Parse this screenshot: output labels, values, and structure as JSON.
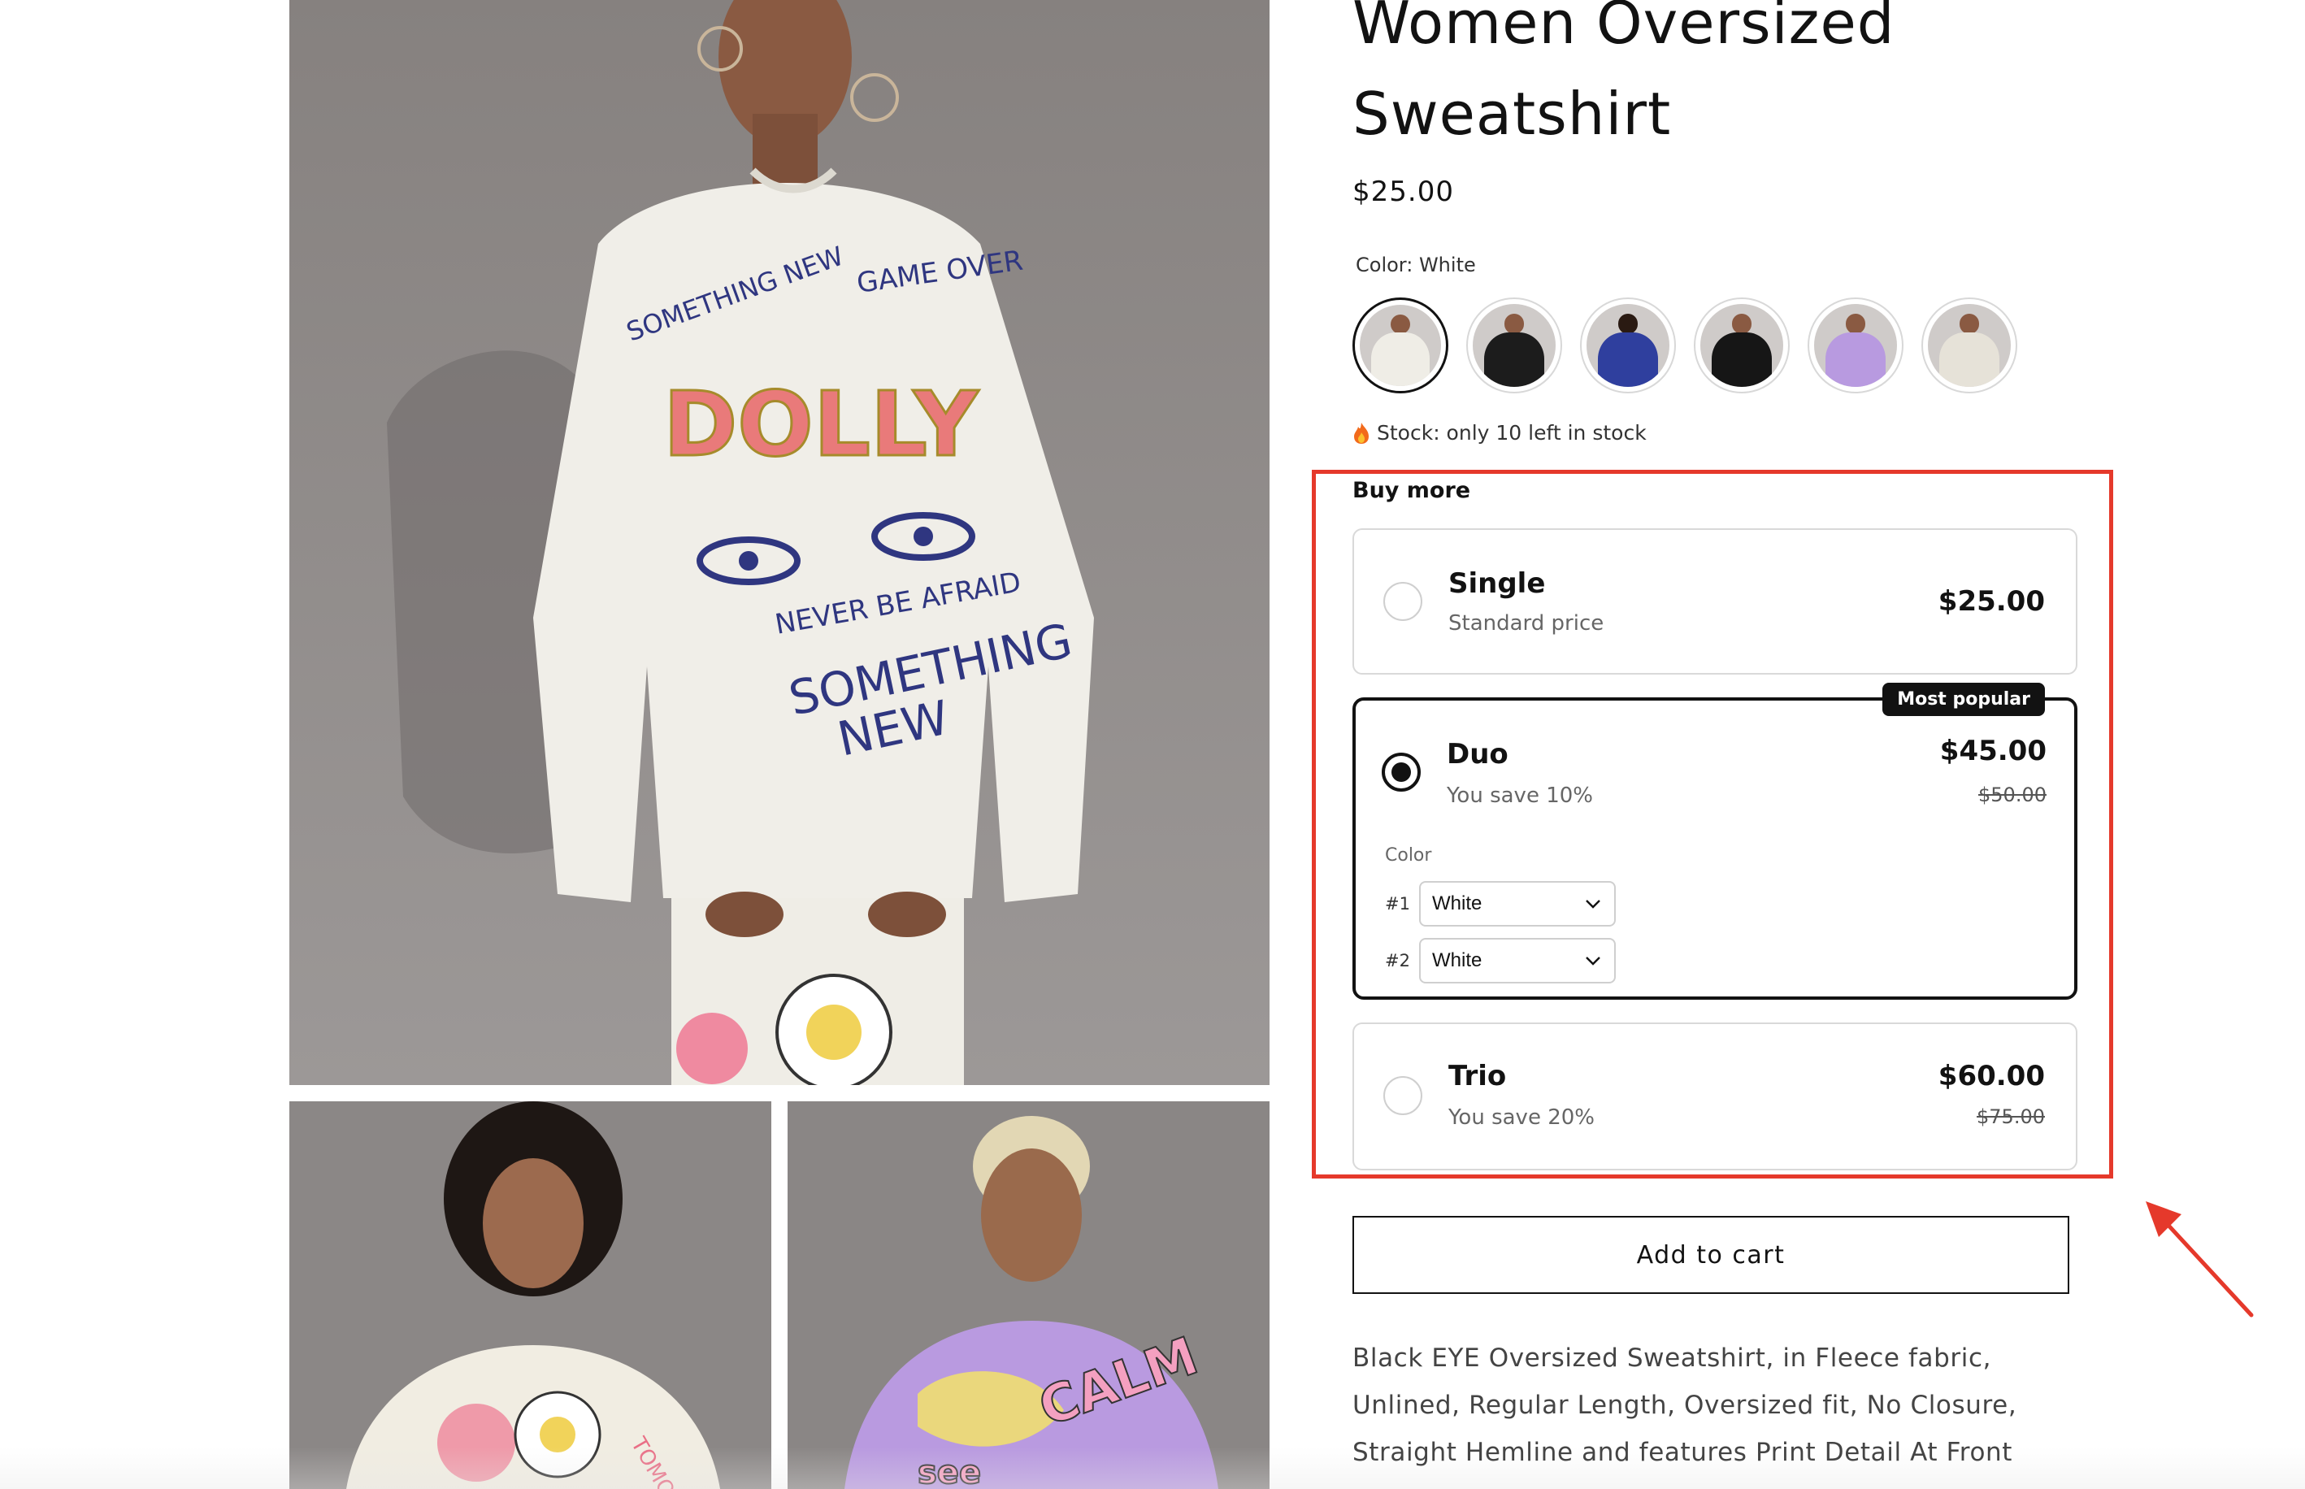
{
  "product": {
    "title_line1": "Women Oversized",
    "title_line2": "Sweatshirt",
    "price": "$25.00",
    "color_label": "Color: White",
    "swatches": [
      {
        "name": "White",
        "color": "#efede6"
      },
      {
        "name": "Black",
        "color": "#1c1c1c"
      },
      {
        "name": "Blue",
        "color": "#2f3f9e"
      },
      {
        "name": "Black",
        "color": "#161616"
      },
      {
        "name": "Purple",
        "color": "#b89ae0"
      },
      {
        "name": "Cream",
        "color": "#e6e2d8"
      }
    ],
    "stock_text": "Stock: only 10 left in stock",
    "description": "Black EYE Oversized Sweatshirt, in Fleece fabric, Unlined, Regular Length, Oversized fit, No Closure, Straight Hemline and features Print Detail At Front"
  },
  "bundle": {
    "heading": "Buy more",
    "options": {
      "single": {
        "name": "Single",
        "subtitle": "Standard price",
        "price": "$25.00",
        "selected": false
      },
      "duo": {
        "name": "Duo",
        "subtitle": "You save 10%",
        "price": "$45.00",
        "compare_price": "$50.00",
        "badge": "Most popular",
        "selected": true,
        "color_label": "Color",
        "variants": [
          {
            "num": "#1",
            "value": "White"
          },
          {
            "num": "#2",
            "value": "White"
          }
        ]
      },
      "trio": {
        "name": "Trio",
        "subtitle": "You save 20%",
        "price": "$60.00",
        "compare_price": "$75.00",
        "selected": false
      }
    }
  },
  "actions": {
    "add_to_cart": "Add to cart"
  },
  "colors": {
    "accent": "#121212",
    "annotation": "#e5392b",
    "photo_bg": "#8f8b8b"
  },
  "icons": [
    "flame-icon",
    "chevron-down-icon",
    "radio-icon"
  ]
}
